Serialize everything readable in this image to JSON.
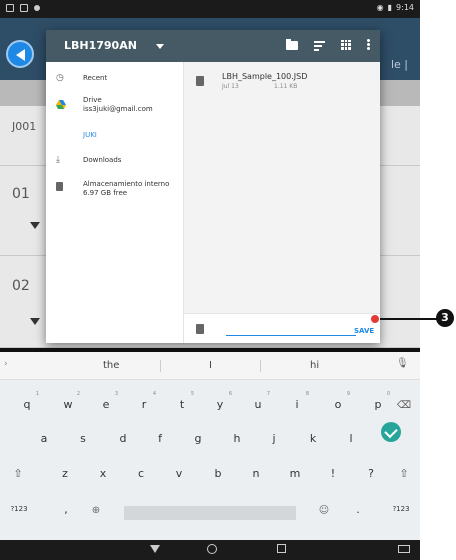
{
  "status_bar": {
    "time": "9:14"
  },
  "background_app": {
    "right_text": "le |",
    "labels": [
      "J001",
      "01",
      "02"
    ]
  },
  "dialog": {
    "title": "LBH1790AN",
    "nav": [
      {
        "label": "Recent",
        "sub": ""
      },
      {
        "label": "Drive",
        "sub": "iss3juki@gmail.com"
      },
      {
        "label": "JUKI",
        "sub": ""
      },
      {
        "label": "Downloads",
        "sub": ""
      },
      {
        "label": "Almacenamiento interno",
        "sub": "6.97 GB free"
      }
    ],
    "file": {
      "name": "LBH_Sample_100.JSD",
      "date": "Jul 13",
      "size": "1.11 KB"
    },
    "save_label": "SAVE",
    "filename_value": ""
  },
  "callout": {
    "number": "3"
  },
  "keyboard": {
    "suggestions": [
      "the",
      "I",
      "hi"
    ],
    "row1": [
      "q",
      "w",
      "e",
      "r",
      "t",
      "y",
      "u",
      "i",
      "o",
      "p"
    ],
    "row1_hints": [
      "1",
      "2",
      "3",
      "4",
      "5",
      "6",
      "7",
      "8",
      "9",
      "0"
    ],
    "row2": [
      "a",
      "s",
      "d",
      "f",
      "g",
      "h",
      "j",
      "k",
      "l"
    ],
    "row3": [
      "z",
      "x",
      "c",
      "v",
      "b",
      "n",
      "m",
      "!",
      "?"
    ],
    "row4_left": "?123",
    "row4_comma": ",",
    "row4_period": ".",
    "row4_right": "?123"
  }
}
